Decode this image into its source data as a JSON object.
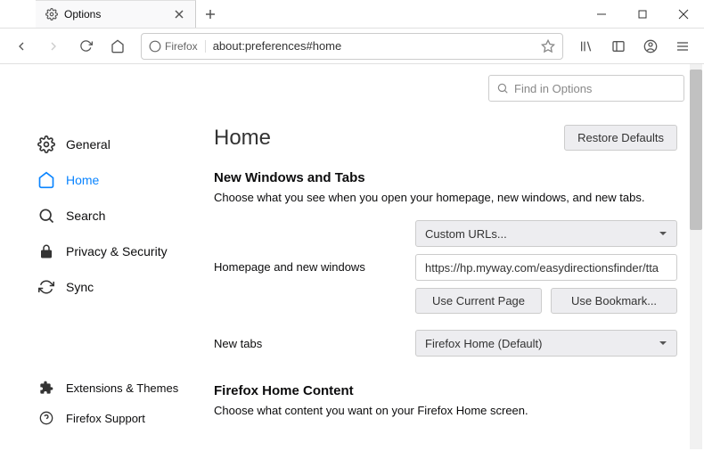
{
  "window": {
    "title": "Options"
  },
  "urlbar": {
    "identity": "Firefox",
    "url": "about:preferences#home"
  },
  "sidebar": {
    "items": [
      {
        "label": "General"
      },
      {
        "label": "Home"
      },
      {
        "label": "Search"
      },
      {
        "label": "Privacy & Security"
      },
      {
        "label": "Sync"
      }
    ],
    "bottom": [
      {
        "label": "Extensions & Themes"
      },
      {
        "label": "Firefox Support"
      }
    ]
  },
  "find": {
    "placeholder": "Find in Options"
  },
  "page": {
    "heading": "Home",
    "restore": "Restore Defaults",
    "section1": {
      "title": "New Windows and Tabs",
      "desc": "Choose what you see when you open your homepage, new windows, and new tabs.",
      "row1_label": "Homepage and new windows",
      "row1_select": "Custom URLs...",
      "row1_input": "https://hp.myway.com/easydirectionsfinder/tta",
      "btn_current": "Use Current Page",
      "btn_bookmark": "Use Bookmark...",
      "row2_label": "New tabs",
      "row2_select": "Firefox Home (Default)"
    },
    "section2": {
      "title": "Firefox Home Content",
      "desc": "Choose what content you want on your Firefox Home screen."
    }
  }
}
